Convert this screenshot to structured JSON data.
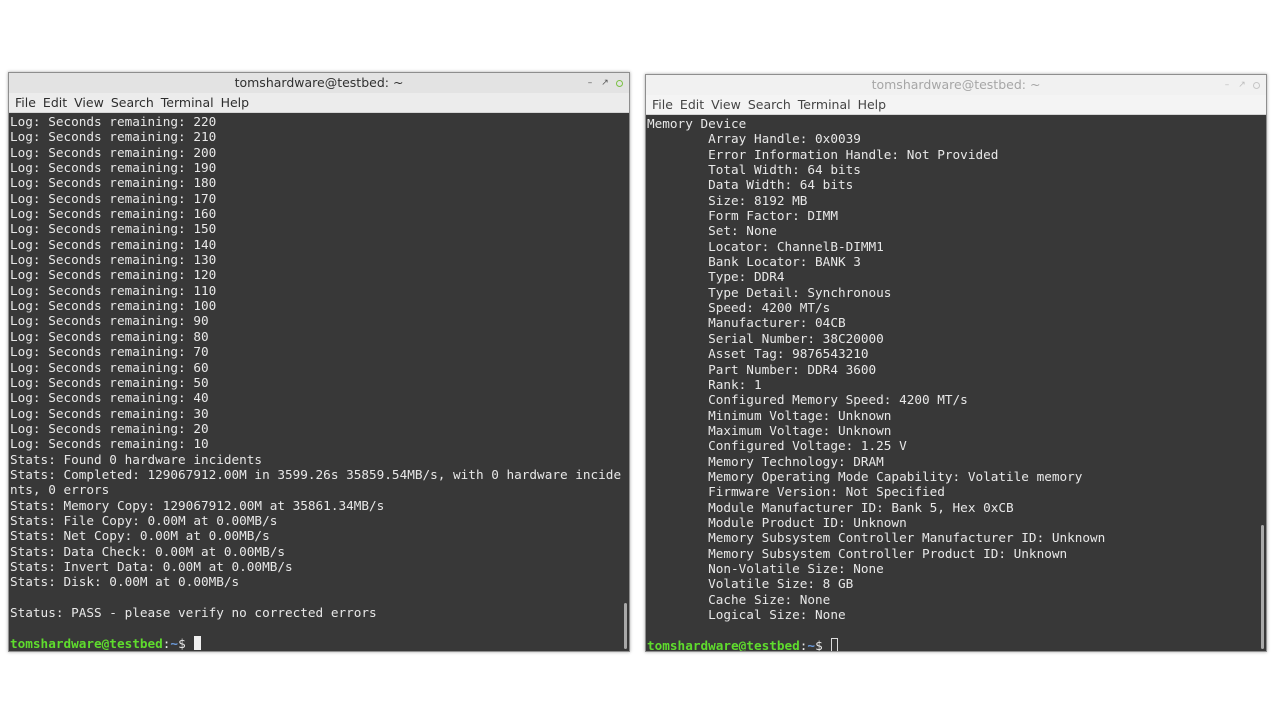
{
  "left_window": {
    "title": "tomshardware@testbed: ~",
    "menu": [
      "File",
      "Edit",
      "View",
      "Search",
      "Terminal",
      "Help"
    ],
    "lines": [
      "Log: Seconds remaining: 220",
      "Log: Seconds remaining: 210",
      "Log: Seconds remaining: 200",
      "Log: Seconds remaining: 190",
      "Log: Seconds remaining: 180",
      "Log: Seconds remaining: 170",
      "Log: Seconds remaining: 160",
      "Log: Seconds remaining: 150",
      "Log: Seconds remaining: 140",
      "Log: Seconds remaining: 130",
      "Log: Seconds remaining: 120",
      "Log: Seconds remaining: 110",
      "Log: Seconds remaining: 100",
      "Log: Seconds remaining: 90",
      "Log: Seconds remaining: 80",
      "Log: Seconds remaining: 70",
      "Log: Seconds remaining: 60",
      "Log: Seconds remaining: 50",
      "Log: Seconds remaining: 40",
      "Log: Seconds remaining: 30",
      "Log: Seconds remaining: 20",
      "Log: Seconds remaining: 10",
      "Stats: Found 0 hardware incidents",
      "Stats: Completed: 129067912.00M in 3599.26s 35859.54MB/s, with 0 hardware incide",
      "nts, 0 errors",
      "Stats: Memory Copy: 129067912.00M at 35861.34MB/s",
      "Stats: File Copy: 0.00M at 0.00MB/s",
      "Stats: Net Copy: 0.00M at 0.00MB/s",
      "Stats: Data Check: 0.00M at 0.00MB/s",
      "Stats: Invert Data: 0.00M at 0.00MB/s",
      "Stats: Disk: 0.00M at 0.00MB/s",
      "",
      "Status: PASS - please verify no corrected errors",
      ""
    ],
    "prompt": {
      "user": "tomshardware@testbed",
      "sep": ":",
      "path": "~",
      "symbol": "$ "
    }
  },
  "right_window": {
    "title": "tomshardware@testbed: ~",
    "menu": [
      "File",
      "Edit",
      "View",
      "Search",
      "Terminal",
      "Help"
    ],
    "lines": [
      "Memory Device",
      "        Array Handle: 0x0039",
      "        Error Information Handle: Not Provided",
      "        Total Width: 64 bits",
      "        Data Width: 64 bits",
      "        Size: 8192 MB",
      "        Form Factor: DIMM",
      "        Set: None",
      "        Locator: ChannelB-DIMM1",
      "        Bank Locator: BANK 3",
      "        Type: DDR4",
      "        Type Detail: Synchronous",
      "        Speed: 4200 MT/s",
      "        Manufacturer: 04CB",
      "        Serial Number: 38C20000",
      "        Asset Tag: 9876543210",
      "        Part Number: DDR4 3600",
      "        Rank: 1",
      "        Configured Memory Speed: 4200 MT/s",
      "        Minimum Voltage: Unknown",
      "        Maximum Voltage: Unknown",
      "        Configured Voltage: 1.25 V",
      "        Memory Technology: DRAM",
      "        Memory Operating Mode Capability: Volatile memory",
      "        Firmware Version: Not Specified",
      "        Module Manufacturer ID: Bank 5, Hex 0xCB",
      "        Module Product ID: Unknown",
      "        Memory Subsystem Controller Manufacturer ID: Unknown",
      "        Memory Subsystem Controller Product ID: Unknown",
      "        Non-Volatile Size: None",
      "        Volatile Size: 8 GB",
      "        Cache Size: None",
      "        Logical Size: None",
      ""
    ],
    "prompt": {
      "user": "tomshardware@testbed",
      "sep": ":",
      "path": "~",
      "symbol": "$ "
    }
  }
}
